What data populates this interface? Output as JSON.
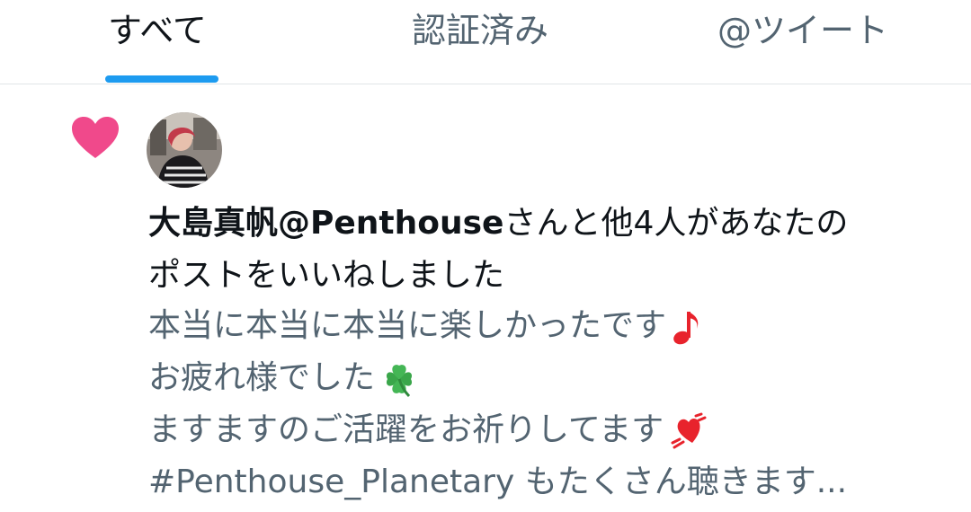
{
  "tabs": [
    {
      "label": "すべて",
      "active": true
    },
    {
      "label": "認証済み",
      "active": false
    },
    {
      "label": "@ツイート",
      "active": false
    }
  ],
  "notification": {
    "type_icon": "heart-icon",
    "type_icon_color": "#f0498b",
    "avatar_icon": "user-avatar-photo",
    "user_name": "大島真帆@Penthouse",
    "action_text_line1": "さんと他4人があなたの",
    "action_text_line2": "ポストをいいねしました",
    "tweet_lines": [
      "本当に本当に本当に楽しかったです",
      "お疲れ様でした",
      "ますますのご活躍をお祈りしてます",
      "#Penthouse_Planetary もたくさん聴きます..."
    ],
    "tweet_emojis": [
      "musical-note-icon",
      "four-leaf-clover-icon",
      "heart-with-ribbon-icon"
    ]
  },
  "colors": {
    "accent": "#1d9bf0",
    "text_primary": "#0f1419",
    "text_secondary": "#536471",
    "like_pink": "#f0498b"
  }
}
